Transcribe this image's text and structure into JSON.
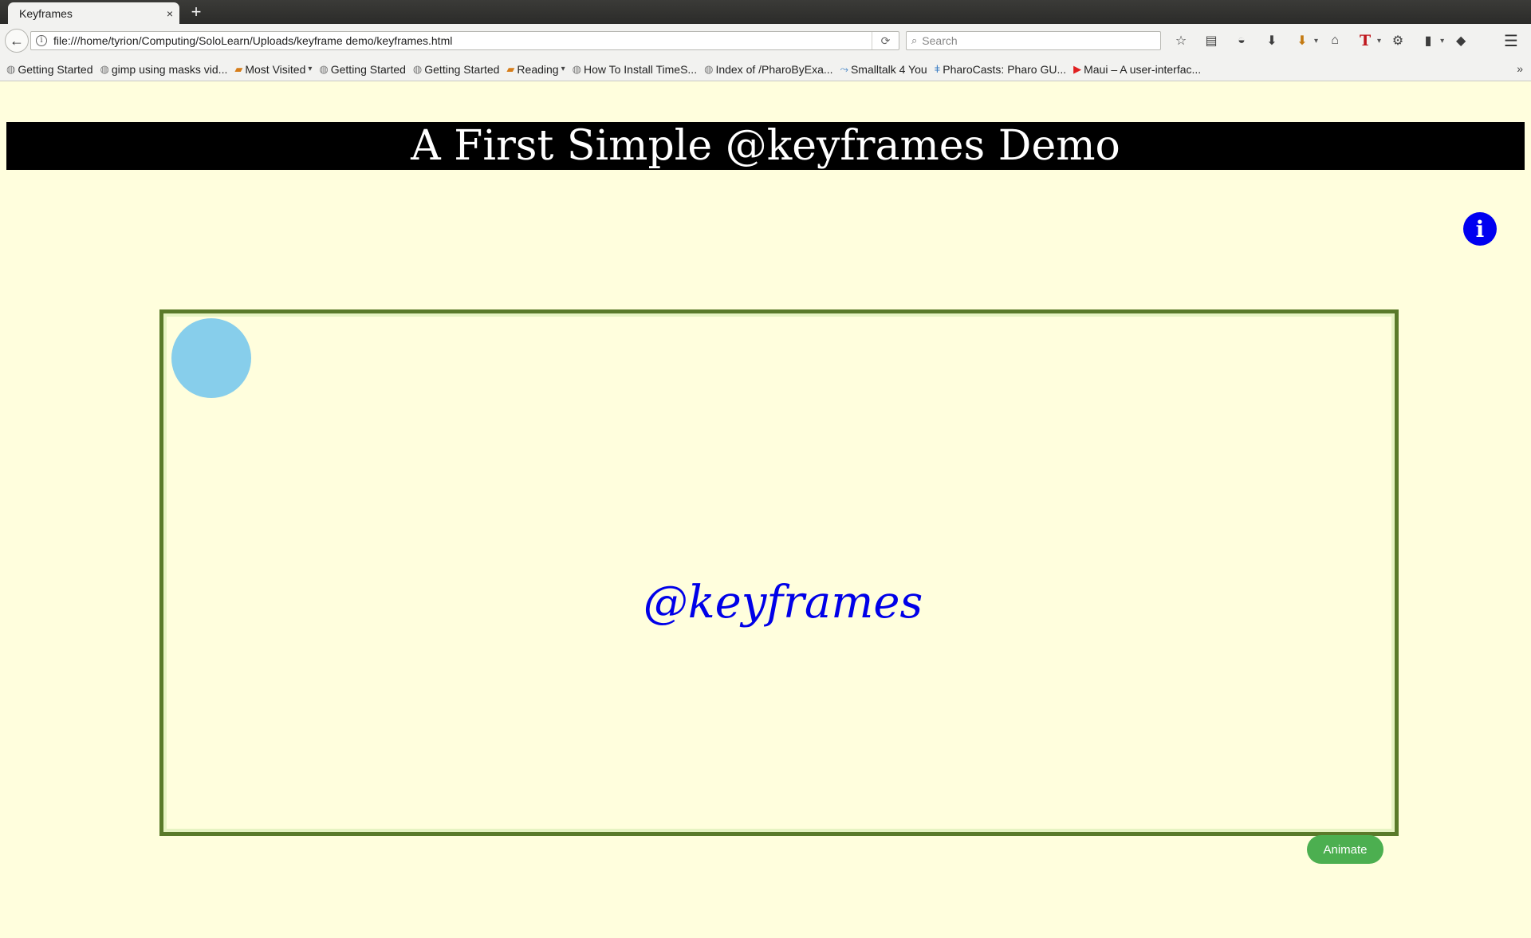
{
  "browser": {
    "tab_title": "Keyframes",
    "tab_close": "×",
    "new_tab": "+",
    "back": "←",
    "info": "i",
    "url": "file:///home/tyrion/Computing/SoloLearn/Uploads/keyframe demo/keyframes.html",
    "reload": "⟳",
    "search_placeholder": "Search",
    "search_icon": "⌕",
    "menu": "☰",
    "toolbar": [
      {
        "name": "bookmark-star-icon",
        "glyph": "☆"
      },
      {
        "name": "reading-list-icon",
        "glyph": "▤"
      },
      {
        "name": "pocket-icon",
        "glyph": "◒"
      },
      {
        "name": "downloads-icon",
        "glyph": "⬇"
      },
      {
        "name": "download-helper-icon",
        "glyph": "⬇"
      },
      {
        "name": "home-icon",
        "glyph": "⌂"
      },
      {
        "name": "text-tool-icon",
        "glyph": "T"
      },
      {
        "name": "extension-icon",
        "glyph": "⚙"
      },
      {
        "name": "clipboard-icon",
        "glyph": "▮"
      },
      {
        "name": "sync-icon",
        "glyph": "◆"
      }
    ]
  },
  "bookmarks": {
    "items": [
      {
        "label": "Getting Started",
        "icon": "globe"
      },
      {
        "label": "gimp using masks vid...",
        "icon": "globe"
      },
      {
        "label": "Most Visited",
        "icon": "folder",
        "dropdown": true
      },
      {
        "label": "Getting Started",
        "icon": "globe"
      },
      {
        "label": "Getting Started",
        "icon": "globe"
      },
      {
        "label": "Reading",
        "icon": "folder",
        "dropdown": true
      },
      {
        "label": "How To Install TimeS...",
        "icon": "globe"
      },
      {
        "label": "Index of /PharoByExa...",
        "icon": "globe"
      },
      {
        "label": "Smalltalk 4 You",
        "icon": "blue"
      },
      {
        "label": "PharoCasts: Pharo GU...",
        "icon": "blue"
      },
      {
        "label": "Maui – A user-interfac...",
        "icon": "youtube"
      }
    ],
    "more": "»"
  },
  "page": {
    "title": "A First Simple @keyframes Demo",
    "info_label": "i",
    "stage_text": "@keyframes",
    "animate_label": "Animate"
  },
  "colors": {
    "page_background": "#fffedd",
    "title_bar": "#000000",
    "info_button": "#0000f0",
    "stage_border": "#5a7a2a",
    "ball": "#87ceeb",
    "stage_text": "#0000e8",
    "animate_button": "#4caf50"
  }
}
